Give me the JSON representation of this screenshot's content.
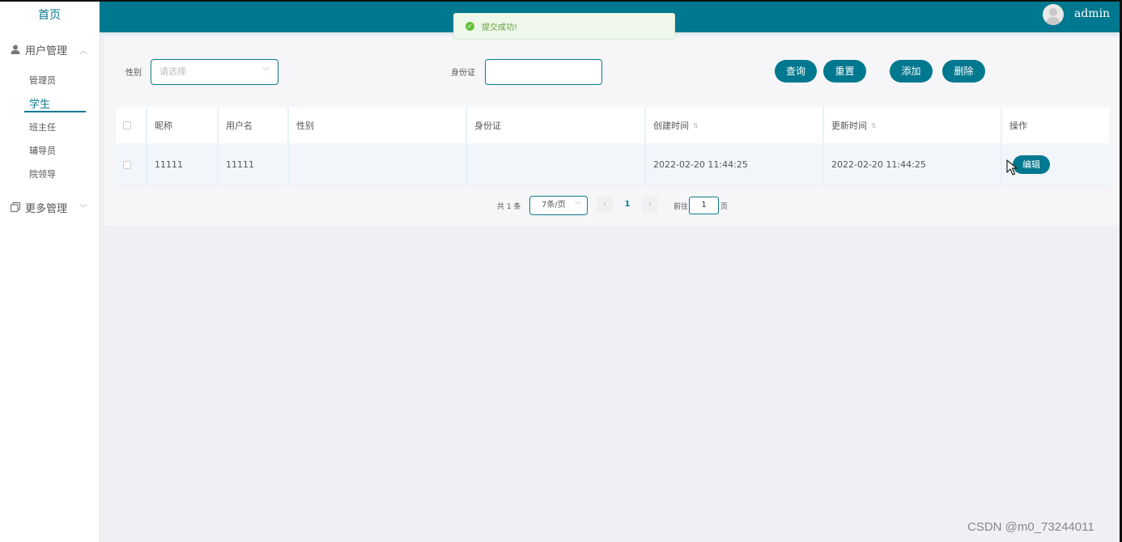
{
  "sidebar": {
    "home": "首页",
    "groups": [
      {
        "label": "用户管理",
        "items": [
          "管理员",
          "学生",
          "班主任",
          "辅导员",
          "院领导"
        ],
        "active": "学生"
      },
      {
        "label": "更多管理"
      }
    ]
  },
  "header": {
    "username": "admin"
  },
  "toast": {
    "message": "提交成功!"
  },
  "search": {
    "gender_label": "性别",
    "gender_placeholder": "请选择",
    "idcard_label": "身份证",
    "idcard_value": ""
  },
  "actions": {
    "query": "查询",
    "reset": "重置",
    "add": "添加",
    "delete": "删除"
  },
  "table": {
    "columns": [
      "昵称",
      "用户名",
      "性别",
      "身份证",
      "创建时间",
      "更新时间",
      "操作"
    ],
    "rows": [
      {
        "nickname": "11111",
        "username": "11111",
        "gender": "",
        "idcard": "",
        "created": "2022-02-20 11:44:25",
        "updated": "2022-02-20 11:44:25",
        "edit": "编辑"
      }
    ]
  },
  "pagination": {
    "total": "共 1 条",
    "page_size": "7条/页",
    "current": "1",
    "goto_prefix": "前往",
    "goto_value": "1",
    "goto_suffix": "页"
  },
  "watermark": "CSDN @m0_73244011",
  "colors": {
    "primary": "#00788f",
    "success": "#67c23a"
  }
}
